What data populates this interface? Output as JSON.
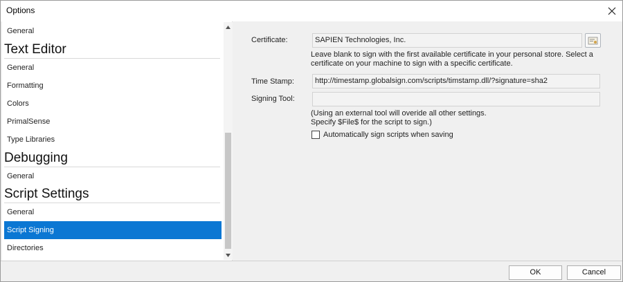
{
  "window": {
    "title": "Options",
    "close_icon": "close-icon"
  },
  "sidebar": {
    "items": [
      {
        "label": "General",
        "selected": false
      },
      {
        "label": "Text Editor",
        "type": "section"
      },
      {
        "label": "General",
        "selected": false
      },
      {
        "label": "Formatting",
        "selected": false
      },
      {
        "label": "Colors",
        "selected": false
      },
      {
        "label": "PrimalSense",
        "selected": false
      },
      {
        "label": "Type Libraries",
        "selected": false
      },
      {
        "label": "Debugging",
        "type": "section"
      },
      {
        "label": "General",
        "selected": false
      },
      {
        "label": "Script Settings",
        "type": "section"
      },
      {
        "label": "General",
        "selected": false
      },
      {
        "label": "Script Signing",
        "selected": true
      },
      {
        "label": "Directories",
        "selected": false
      }
    ]
  },
  "settings": {
    "certificate_label": "Certificate:",
    "certificate_value": "SAPIEN Technologies, Inc.",
    "certificate_hint_line1": "Leave blank to sign with the first available certificate in your personal store. Select a",
    "certificate_hint_line2": "certificate on your machine to sign with a specific certificate.",
    "timestamp_label": "Time Stamp:",
    "timestamp_value": "http://timestamp.globalsign.com/scripts/timstamp.dll/?signature=sha2",
    "signing_tool_label": "Signing Tool:",
    "signing_tool_value": "",
    "signing_tool_hint_line1": "(Using an external tool will overide all other settings.",
    "signing_tool_hint_line2": "Specify $File$ for the script to sign.)",
    "auto_sign_label": "Automatically sign scripts when saving",
    "auto_sign_checked": false
  },
  "buttons": {
    "ok_label": "OK",
    "cancel_label": "Cancel"
  },
  "colors": {
    "selection": "#0b77d3"
  }
}
